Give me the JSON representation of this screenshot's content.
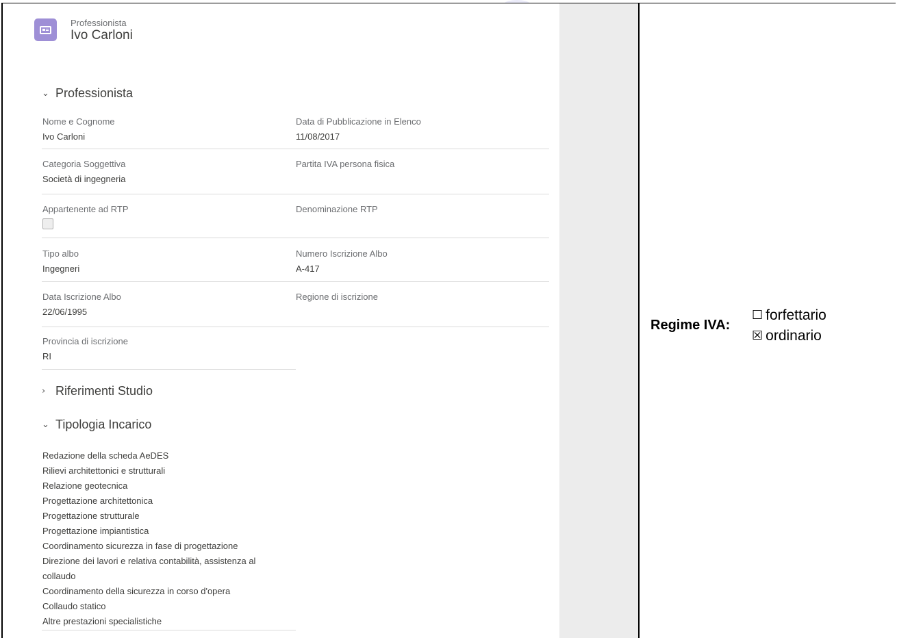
{
  "header": {
    "object_type": "Professionista",
    "record_name": "Ivo Carloni"
  },
  "sections": {
    "professionista": {
      "title": "Professionista",
      "fields": {
        "nome_cognome": {
          "label": "Nome e Cognome",
          "value": "Ivo Carloni"
        },
        "data_pubblicazione": {
          "label": "Data di Pubblicazione in Elenco",
          "value": "11/08/2017"
        },
        "categoria": {
          "label": "Categoria Soggettiva",
          "value": "Società di ingegneria"
        },
        "partita_iva": {
          "label": "Partita IVA persona fisica",
          "value": ""
        },
        "appartenente_rtp": {
          "label": "Appartenente ad RTP",
          "checked": false
        },
        "denominazione_rtp": {
          "label": "Denominazione RTP",
          "value": ""
        },
        "tipo_albo": {
          "label": "Tipo albo",
          "value": "Ingegneri"
        },
        "numero_iscrizione": {
          "label": "Numero Iscrizione Albo",
          "value": "A-417"
        },
        "data_iscrizione": {
          "label": "Data Iscrizione Albo",
          "value": "22/06/1995"
        },
        "regione": {
          "label": "Regione di iscrizione",
          "value": ""
        },
        "provincia": {
          "label": "Provincia di iscrizione",
          "value": "RI"
        }
      }
    },
    "riferimenti": {
      "title": "Riferimenti Studio",
      "expanded": false
    },
    "tipologia": {
      "title": "Tipologia Incarico",
      "items": [
        "Redazione della scheda AeDES",
        "Rilievi architettonici e strutturali",
        "Relazione geotecnica",
        "Progettazione architettonica",
        "Progettazione strutturale",
        "Progettazione impiantistica",
        "Coordinamento sicurezza in fase di progettazione",
        "Direzione dei lavori e relativa contabilità, assistenza al",
        "collaudo",
        "Coordinamento della sicurezza in corso d'opera",
        "Collaudo statico",
        "Altre prestazioni specialistiche"
      ]
    }
  },
  "regime_iva": {
    "label": "Regime IVA:",
    "options": [
      {
        "label": "forfettario",
        "checked": false,
        "glyph": "☐"
      },
      {
        "label": "ordinario",
        "checked": true,
        "glyph": "☒"
      }
    ]
  },
  "icons": {
    "record": "contact-card-icon",
    "expanded": "chevron-down-icon",
    "collapsed": "chevron-right-icon"
  },
  "colors": {
    "record_icon_bg": "#9e8fd6",
    "side_column": "#ececec"
  }
}
